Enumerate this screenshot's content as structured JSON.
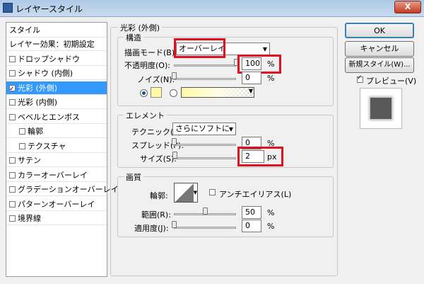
{
  "window": {
    "title": "レイヤースタイル",
    "close": "X"
  },
  "style_list": {
    "header": "スタイル",
    "items": [
      {
        "label": "レイヤー効果：初期設定",
        "checkbox": false,
        "checked": false
      },
      {
        "label": "ドロップシャドウ",
        "checkbox": true,
        "checked": false
      },
      {
        "label": "シャドウ (内側)",
        "checkbox": true,
        "checked": false
      },
      {
        "label": "光彩 (外側)",
        "checkbox": true,
        "checked": true,
        "selected": true
      },
      {
        "label": "光彩 (内側)",
        "checkbox": true,
        "checked": false
      },
      {
        "label": "ベベルとエンボス",
        "checkbox": true,
        "checked": false
      },
      {
        "label": "輪郭",
        "checkbox": true,
        "checked": false,
        "indent": true
      },
      {
        "label": "テクスチャ",
        "checkbox": true,
        "checked": false,
        "indent": true
      },
      {
        "label": "サテン",
        "checkbox": true,
        "checked": false
      },
      {
        "label": "カラーオーバーレイ",
        "checkbox": true,
        "checked": false
      },
      {
        "label": "グラデーションオーバーレイ",
        "checkbox": true,
        "checked": false
      },
      {
        "label": "パターンオーバーレイ",
        "checkbox": true,
        "checked": false
      },
      {
        "label": "境界線",
        "checkbox": true,
        "checked": false
      }
    ]
  },
  "outer_glow": {
    "section_title": "光彩 (外側)",
    "structure": {
      "title": "構造",
      "blend_mode_label": "描画モード(B):",
      "blend_mode_value": "オーバーレイ",
      "opacity_label": "不透明度(O):",
      "opacity_value": "100",
      "opacity_unit": "%",
      "opacity_level": 1.0,
      "noise_label": "ノイズ(N):",
      "noise_value": "0",
      "noise_unit": "%",
      "noise_level": 0.0,
      "solid_color": "#fffaa8"
    },
    "elements": {
      "title": "エレメント",
      "technique_label": "テクニック(T):",
      "technique_value": "さらにソフトに",
      "spread_label": "スプレッド(P):",
      "spread_value": "0",
      "spread_unit": "%",
      "spread_level": 0.0,
      "size_label": "サイズ(S):",
      "size_value": "2",
      "size_unit": "px",
      "size_level": 0.01
    },
    "quality": {
      "title": "画質",
      "contour_label": "輪郭:",
      "antialias_label": "アンチエイリアス(L)",
      "range_label": "範囲(R):",
      "range_value": "50",
      "range_unit": "%",
      "range_level": 0.5,
      "jitter_label": "適用度(J):",
      "jitter_value": "0",
      "jitter_unit": "%",
      "jitter_level": 0.0
    }
  },
  "buttons": {
    "ok": "OK",
    "cancel": "キャンセル",
    "new_style": "新規スタイル(W)...",
    "preview_label": "プレビュー(V)",
    "preview_checked": true
  },
  "colors": {
    "highlight": "#e0101e",
    "selected": "#3399ff"
  }
}
